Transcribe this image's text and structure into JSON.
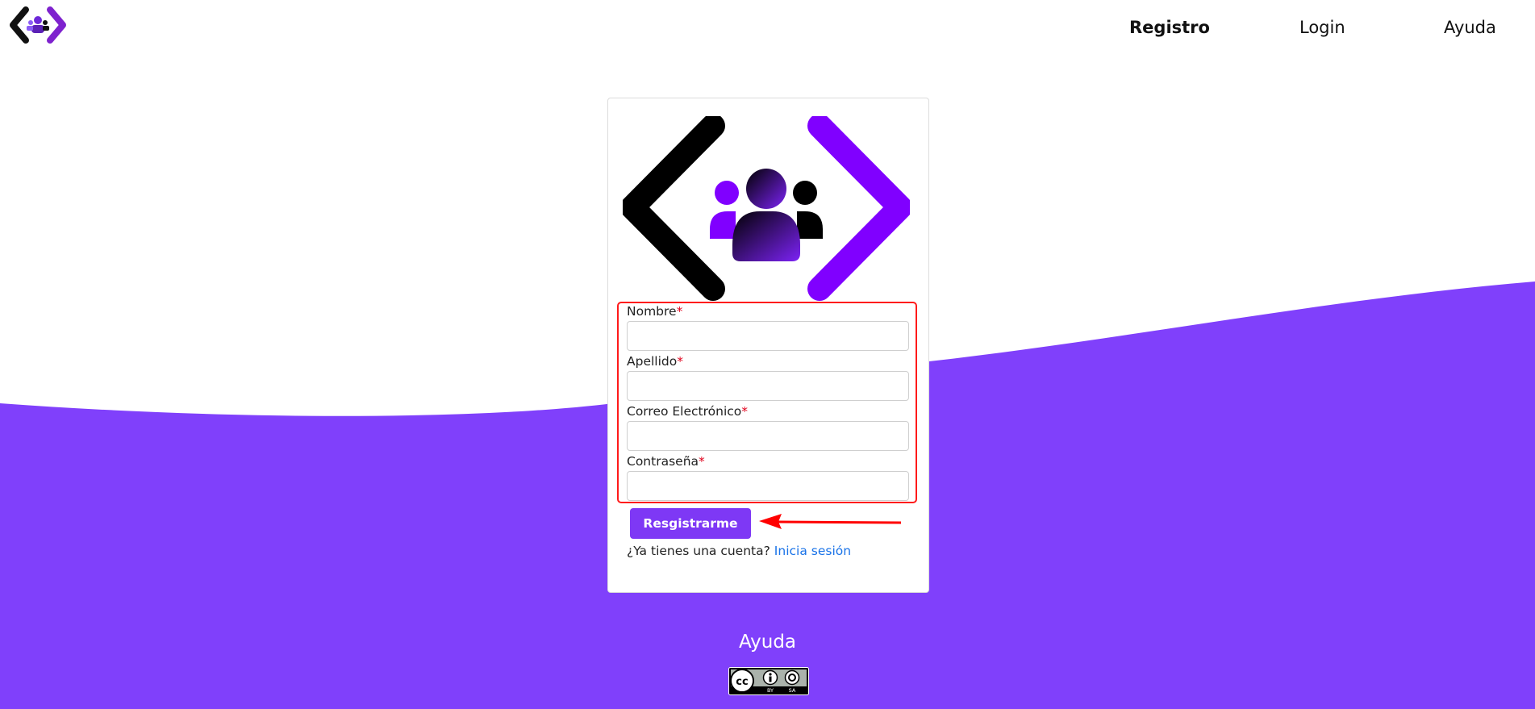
{
  "nav": {
    "items": [
      {
        "label": "Registro",
        "active": true
      },
      {
        "label": "Login",
        "active": false
      },
      {
        "label": "Ayuda",
        "active": false
      }
    ]
  },
  "brand": {
    "logo_icon": "team-code-brackets-logo"
  },
  "form": {
    "fields": [
      {
        "label": "Nombre",
        "required_mark": "*",
        "value": ""
      },
      {
        "label": "Apellido",
        "required_mark": "*",
        "value": ""
      },
      {
        "label": "Correo Electrónico",
        "required_mark": "*",
        "value": ""
      },
      {
        "label": "Contraseña",
        "required_mark": "*",
        "value": ""
      }
    ],
    "submit_label": "Resgistrarme",
    "login_prompt": "¿Ya tienes una cuenta?",
    "login_link": "Inicia sesión"
  },
  "footer": {
    "help_link": "Ayuda",
    "license_badge": {
      "icon": "cc-by-sa-icon",
      "text_by": "BY",
      "text_sa": "SA"
    }
  },
  "colors": {
    "accent": "#7e38f5",
    "wave": "#8040fb",
    "link": "#1a73e8",
    "highlight": "#ff1a1a",
    "required": "#e0001b"
  }
}
